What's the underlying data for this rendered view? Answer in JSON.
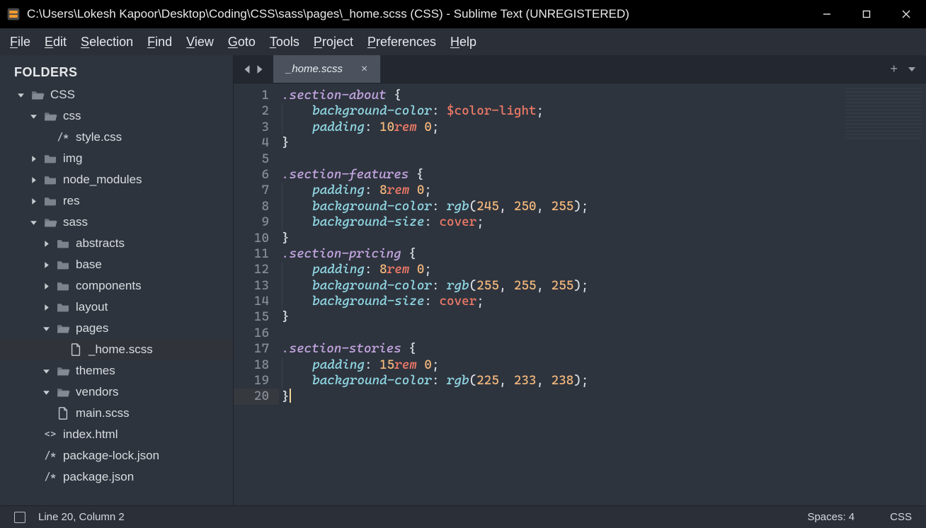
{
  "window": {
    "title": "C:\\Users\\Lokesh Kapoor\\Desktop\\Coding\\CSS\\sass\\pages\\_home.scss (CSS) - Sublime Text (UNREGISTERED)"
  },
  "menu": {
    "items": [
      "File",
      "Edit",
      "Selection",
      "Find",
      "View",
      "Goto",
      "Tools",
      "Project",
      "Preferences",
      "Help"
    ]
  },
  "sidebar": {
    "title": "FOLDERS",
    "tree": [
      {
        "depth": 0,
        "type": "folder-open",
        "twisty": "down",
        "label": "CSS"
      },
      {
        "depth": 1,
        "type": "folder-open",
        "twisty": "down",
        "label": "css"
      },
      {
        "depth": 2,
        "type": "glyph",
        "glyph": "/*",
        "label": "style.css"
      },
      {
        "depth": 1,
        "type": "folder",
        "twisty": "right",
        "label": "img"
      },
      {
        "depth": 1,
        "type": "folder",
        "twisty": "right",
        "label": "node_modules"
      },
      {
        "depth": 1,
        "type": "folder",
        "twisty": "right",
        "label": "res"
      },
      {
        "depth": 1,
        "type": "folder-open",
        "twisty": "down",
        "label": "sass"
      },
      {
        "depth": 2,
        "type": "folder",
        "twisty": "right",
        "label": "abstracts"
      },
      {
        "depth": 2,
        "type": "folder",
        "twisty": "right",
        "label": "base"
      },
      {
        "depth": 2,
        "type": "folder",
        "twisty": "right",
        "label": "components"
      },
      {
        "depth": 2,
        "type": "folder",
        "twisty": "right",
        "label": "layout"
      },
      {
        "depth": 2,
        "type": "folder-open",
        "twisty": "down",
        "label": "pages"
      },
      {
        "depth": 3,
        "type": "file",
        "label": "_home.scss",
        "current": true
      },
      {
        "depth": 2,
        "type": "folder-open",
        "twisty": "down",
        "label": "themes"
      },
      {
        "depth": 2,
        "type": "folder-open",
        "twisty": "down",
        "label": "vendors"
      },
      {
        "depth": 2,
        "type": "file",
        "label": "main.scss"
      },
      {
        "depth": 1,
        "type": "glyph",
        "glyph": "<>",
        "label": "index.html"
      },
      {
        "depth": 1,
        "type": "glyph",
        "glyph": "/*",
        "label": "package-lock.json"
      },
      {
        "depth": 1,
        "type": "glyph",
        "glyph": "/*",
        "label": "package.json"
      }
    ]
  },
  "tabs": {
    "active": "_home.scss"
  },
  "code": {
    "lines": [
      [
        {
          "t": "sel",
          "v": ".section-about"
        },
        {
          "t": "sp"
        },
        {
          "t": "punc",
          "v": "{"
        }
      ],
      [
        {
          "t": "ind"
        },
        {
          "t": "prop",
          "v": "background-color"
        },
        {
          "t": "punc",
          "v": ":"
        },
        {
          "t": "sp"
        },
        {
          "t": "var",
          "v": "$color-light"
        },
        {
          "t": "punc",
          "v": ";"
        }
      ],
      [
        {
          "t": "ind"
        },
        {
          "t": "prop",
          "v": "padding"
        },
        {
          "t": "punc",
          "v": ":"
        },
        {
          "t": "sp"
        },
        {
          "t": "num",
          "v": "10"
        },
        {
          "t": "unit",
          "v": "rem"
        },
        {
          "t": "sp"
        },
        {
          "t": "num",
          "v": "0"
        },
        {
          "t": "punc",
          "v": ";"
        }
      ],
      [
        {
          "t": "punc",
          "v": "}"
        }
      ],
      [],
      [
        {
          "t": "sel",
          "v": ".section-features"
        },
        {
          "t": "sp"
        },
        {
          "t": "punc",
          "v": "{"
        }
      ],
      [
        {
          "t": "ind"
        },
        {
          "t": "prop",
          "v": "padding"
        },
        {
          "t": "punc",
          "v": ":"
        },
        {
          "t": "sp"
        },
        {
          "t": "num",
          "v": "8"
        },
        {
          "t": "unit",
          "v": "rem"
        },
        {
          "t": "sp"
        },
        {
          "t": "num",
          "v": "0"
        },
        {
          "t": "punc",
          "v": ";"
        }
      ],
      [
        {
          "t": "ind"
        },
        {
          "t": "prop",
          "v": "background-color"
        },
        {
          "t": "punc",
          "v": ":"
        },
        {
          "t": "sp"
        },
        {
          "t": "func",
          "v": "rgb"
        },
        {
          "t": "punc",
          "v": "("
        },
        {
          "t": "num",
          "v": "245"
        },
        {
          "t": "punc",
          "v": ","
        },
        {
          "t": "sp"
        },
        {
          "t": "num",
          "v": "250"
        },
        {
          "t": "punc",
          "v": ","
        },
        {
          "t": "sp"
        },
        {
          "t": "num",
          "v": "255"
        },
        {
          "t": "punc",
          "v": ")"
        },
        {
          "t": "punc",
          "v": ";"
        }
      ],
      [
        {
          "t": "ind"
        },
        {
          "t": "prop",
          "v": "background-size"
        },
        {
          "t": "punc",
          "v": ":"
        },
        {
          "t": "sp"
        },
        {
          "t": "kw2",
          "v": "cover"
        },
        {
          "t": "punc",
          "v": ";"
        }
      ],
      [
        {
          "t": "punc",
          "v": "}"
        }
      ],
      [
        {
          "t": "sel",
          "v": ".section-pricing"
        },
        {
          "t": "sp"
        },
        {
          "t": "punc",
          "v": "{"
        }
      ],
      [
        {
          "t": "ind"
        },
        {
          "t": "prop",
          "v": "padding"
        },
        {
          "t": "punc",
          "v": ":"
        },
        {
          "t": "sp"
        },
        {
          "t": "num",
          "v": "8"
        },
        {
          "t": "unit",
          "v": "rem"
        },
        {
          "t": "sp"
        },
        {
          "t": "num",
          "v": "0"
        },
        {
          "t": "punc",
          "v": ";"
        }
      ],
      [
        {
          "t": "ind"
        },
        {
          "t": "prop",
          "v": "background-color"
        },
        {
          "t": "punc",
          "v": ":"
        },
        {
          "t": "sp"
        },
        {
          "t": "func",
          "v": "rgb"
        },
        {
          "t": "punc",
          "v": "("
        },
        {
          "t": "num",
          "v": "255"
        },
        {
          "t": "punc",
          "v": ","
        },
        {
          "t": "sp"
        },
        {
          "t": "num",
          "v": "255"
        },
        {
          "t": "punc",
          "v": ","
        },
        {
          "t": "sp"
        },
        {
          "t": "num",
          "v": "255"
        },
        {
          "t": "punc",
          "v": ")"
        },
        {
          "t": "punc",
          "v": ";"
        }
      ],
      [
        {
          "t": "ind"
        },
        {
          "t": "prop",
          "v": "background-size"
        },
        {
          "t": "punc",
          "v": ":"
        },
        {
          "t": "sp"
        },
        {
          "t": "kw2",
          "v": "cover"
        },
        {
          "t": "punc",
          "v": ";"
        }
      ],
      [
        {
          "t": "punc",
          "v": "}"
        }
      ],
      [],
      [
        {
          "t": "sel",
          "v": ".section-stories"
        },
        {
          "t": "sp"
        },
        {
          "t": "punc",
          "v": "{"
        }
      ],
      [
        {
          "t": "ind"
        },
        {
          "t": "prop",
          "v": "padding"
        },
        {
          "t": "punc",
          "v": ":"
        },
        {
          "t": "sp"
        },
        {
          "t": "num",
          "v": "15"
        },
        {
          "t": "unit",
          "v": "rem"
        },
        {
          "t": "sp"
        },
        {
          "t": "num",
          "v": "0"
        },
        {
          "t": "punc",
          "v": ";"
        }
      ],
      [
        {
          "t": "ind"
        },
        {
          "t": "prop",
          "v": "background-color"
        },
        {
          "t": "punc",
          "v": ":"
        },
        {
          "t": "sp"
        },
        {
          "t": "func",
          "v": "rgb"
        },
        {
          "t": "punc",
          "v": "("
        },
        {
          "t": "num",
          "v": "225"
        },
        {
          "t": "punc",
          "v": ","
        },
        {
          "t": "sp"
        },
        {
          "t": "num",
          "v": "233"
        },
        {
          "t": "punc",
          "v": ","
        },
        {
          "t": "sp"
        },
        {
          "t": "num",
          "v": "238"
        },
        {
          "t": "punc",
          "v": ")"
        },
        {
          "t": "punc",
          "v": ";"
        }
      ],
      [
        {
          "t": "punc",
          "v": "}"
        },
        {
          "t": "cursor"
        }
      ]
    ],
    "current_line_index": 19
  },
  "status": {
    "pos": "Line 20, Column 2",
    "spaces": "Spaces: 4",
    "lang": "CSS"
  }
}
